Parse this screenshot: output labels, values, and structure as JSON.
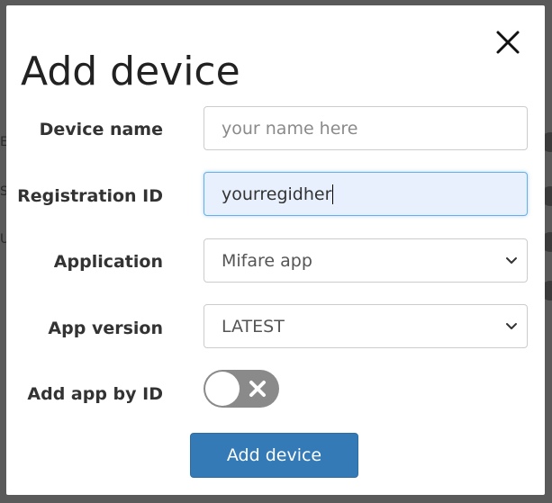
{
  "modal": {
    "title": "Add device",
    "close_icon": "close-icon"
  },
  "form": {
    "device_name": {
      "label": "Device name",
      "placeholder": "your name here",
      "value": ""
    },
    "registration_id": {
      "label": "Registration ID",
      "value": "yourregidher"
    },
    "application": {
      "label": "Application",
      "selected": "Mifare app"
    },
    "app_version": {
      "label": "App version",
      "selected": "LATEST"
    },
    "add_app_by_id": {
      "label": "Add app by ID",
      "enabled": false
    },
    "submit_label": "Add device"
  },
  "colors": {
    "primary": "#337ab7",
    "focus_bg": "#e8f0fe",
    "toggle_off": "#8a8a8a"
  }
}
